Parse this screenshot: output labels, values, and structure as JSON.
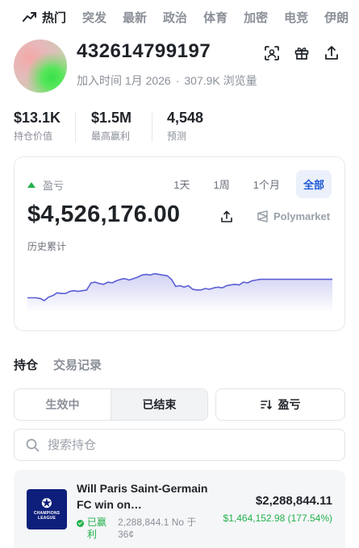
{
  "nav": {
    "items": [
      {
        "label": "热门",
        "active": true
      },
      {
        "label": "突发",
        "active": false
      },
      {
        "label": "最新",
        "active": false
      },
      {
        "label": "政治",
        "active": false
      },
      {
        "label": "体育",
        "active": false
      },
      {
        "label": "加密",
        "active": false
      },
      {
        "label": "电竞",
        "active": false
      },
      {
        "label": "伊朗",
        "active": false
      }
    ]
  },
  "profile": {
    "username": "432614799197",
    "joined": "加入时间 1月 2026",
    "views": "307.9K 浏览量"
  },
  "stats": [
    {
      "value": "$13.1K",
      "label": "持仓价值"
    },
    {
      "value": "$1.5M",
      "label": "最高赢利"
    },
    {
      "value": "4,548",
      "label": "预测"
    }
  ],
  "pnl": {
    "label": "盈亏",
    "value": "$4,526,176.00",
    "subtitle": "历史累计",
    "brand": "Polymarket",
    "ranges": [
      "1天",
      "1周",
      "1个月",
      "全部"
    ],
    "active_range": "全部",
    "accent": "#5b5fd6",
    "chart_values": [
      0.08,
      0.08,
      0.08,
      0.06,
      0.0,
      0.1,
      0.14,
      0.22,
      0.2,
      0.2,
      0.26,
      0.28,
      0.26,
      0.28,
      0.3,
      0.5,
      0.52,
      0.48,
      0.46,
      0.52,
      0.5,
      0.56,
      0.6,
      0.62,
      0.58,
      0.62,
      0.66,
      0.72,
      0.74,
      0.72,
      0.76,
      0.74,
      0.72,
      0.7,
      0.6,
      0.4,
      0.42,
      0.38,
      0.42,
      0.32,
      0.3,
      0.3,
      0.34,
      0.32,
      0.36,
      0.38,
      0.36,
      0.42,
      0.44,
      0.46,
      0.44,
      0.52,
      0.5,
      0.56,
      0.58,
      0.6,
      0.6,
      0.6,
      0.6,
      0.6,
      0.6,
      0.6,
      0.6,
      0.6,
      0.6,
      0.6,
      0.6,
      0.6,
      0.6,
      0.6,
      0.6,
      0.6,
      0.6
    ]
  },
  "tabs": {
    "positions": "持仓",
    "history": "交易记录"
  },
  "filters": {
    "active": "生效中",
    "closed": "已结束",
    "sort": "盈亏"
  },
  "search": {
    "placeholder": "搜索持仓"
  },
  "position": {
    "logo_text": "CHAMPIONS LEAGUE",
    "title": "Will Paris Saint-Germain FC win on…",
    "status": "已赢利",
    "shares": "2,288,844.1 No 于 36¢",
    "value": "$2,288,844.11",
    "pnl": "$1,464,152.98 (177.54%)"
  }
}
